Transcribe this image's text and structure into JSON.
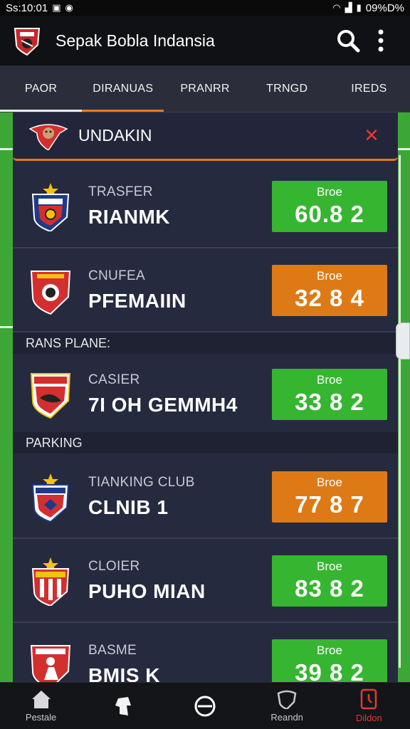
{
  "status_bar": {
    "time": "Ss:10:01",
    "battery": "09%D%"
  },
  "app": {
    "title": "Sepak Bobla Indansia",
    "search_icon": "search-icon",
    "menu_icon": "more-vert-icon"
  },
  "tabs": [
    "PAOR",
    "DIRANUAS",
    "PRANRR",
    "TRNGD",
    "IREDS"
  ],
  "panel": {
    "title": "UNDAKIN",
    "close_symbol": "✕"
  },
  "sections": {
    "s1": "RANS PLANE:",
    "s2": "PARKING"
  },
  "cards": [
    {
      "sub": "TRASFER",
      "main": "RIANMK",
      "score_label": "Broe",
      "score": "60.8 2",
      "color": "green",
      "crest": "shield-star"
    },
    {
      "sub": "CNUFEA",
      "main": "PFEMAIIN",
      "score_label": "Broe",
      "score": "32 8 4",
      "color": "orange",
      "crest": "shield-lion"
    },
    {
      "sub": "CASIER",
      "main": "7I OH GEMMH4",
      "score_label": "Broe",
      "score": "33 8 2",
      "color": "green",
      "crest": "shield-eagle"
    },
    {
      "sub": "TIANKING CLUB",
      "main": "CLNIB 1",
      "score_label": "Broe",
      "score": "77 8 7",
      "color": "orange",
      "crest": "shield-star-blue"
    },
    {
      "sub": "CLOIER",
      "main": "PUHO MIAN",
      "score_label": "Broe",
      "score": "83 8 2",
      "color": "green",
      "crest": "shield-star-stripes"
    },
    {
      "sub": "BASME",
      "main": "BMIS K",
      "score_label": "Broe",
      "score": "39 8 2",
      "color": "green",
      "crest": "shield-player"
    }
  ],
  "bottom_nav": [
    {
      "label": "Pestale",
      "icon": "home-icon"
    },
    {
      "label": "",
      "icon": "player-icon"
    },
    {
      "label": "",
      "icon": "target-icon"
    },
    {
      "label": "Reandn",
      "icon": "shield-outline-icon"
    },
    {
      "label": "Dildon",
      "icon": "trophy-icon",
      "active": true
    }
  ],
  "colors": {
    "accent_orange": "#e27a17",
    "score_green": "#36b531",
    "score_orange": "#dd7a16",
    "close_red": "#e53935"
  }
}
